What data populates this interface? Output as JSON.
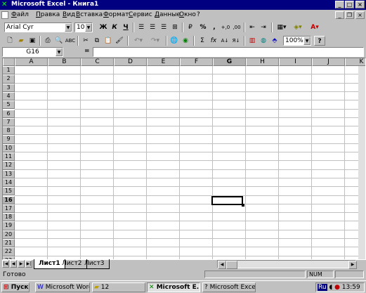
{
  "window": {
    "title": "Microsoft Excel - Книга1"
  },
  "menu": [
    "Файл",
    "Правка",
    "Вид",
    "Вставка",
    "Формат",
    "Сервис",
    "Данные",
    "Окно",
    "?"
  ],
  "format_toolbar": {
    "font": "Arial Cyr",
    "size": "10",
    "bold": "Ж",
    "italic": "К",
    "underline": "Ч",
    "percent": "%",
    "comma": ",",
    "currency": "₽",
    "increase_decimal": "+,0",
    "decrease_decimal": ",00"
  },
  "standard_toolbar": {
    "zoom": "100%",
    "sum": "Σ",
    "function": "fx",
    "help": "?"
  },
  "formula_bar": {
    "name_box": "G16",
    "equals": "=",
    "content": ""
  },
  "grid": {
    "columns": [
      "A",
      "B",
      "C",
      "D",
      "E",
      "F",
      "G",
      "H",
      "I",
      "J",
      "K"
    ],
    "rows": [
      "1",
      "2",
      "3",
      "4",
      "5",
      "6",
      "7",
      "8",
      "9",
      "10",
      "11",
      "12",
      "13",
      "14",
      "15",
      "16",
      "17",
      "18",
      "19",
      "20",
      "21",
      "22",
      "23"
    ],
    "selected_cell": "G16"
  },
  "sheets": [
    "Лист1",
    "Лист2",
    "Лист3"
  ],
  "status": {
    "text": "Готово",
    "num": "NUM"
  },
  "taskbar": {
    "start": "Пуск",
    "tasks": [
      "Microsoft Word...",
      "12",
      "Microsoft E...",
      "Microsoft Excel"
    ],
    "lang": "Ru",
    "clock": "13:59"
  }
}
